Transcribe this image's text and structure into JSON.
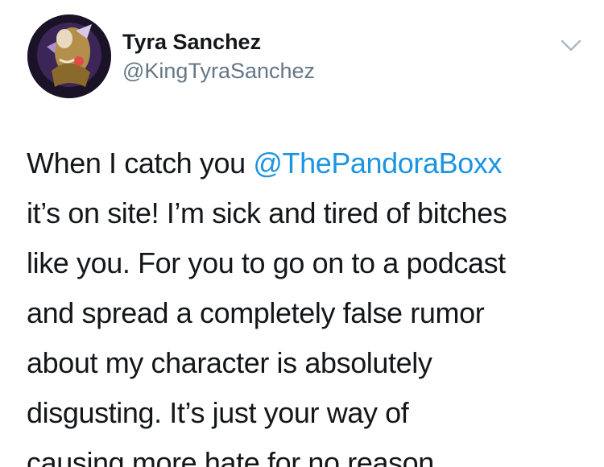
{
  "tweet": {
    "author": {
      "display_name": "Tyra Sanchez",
      "handle": "@KingTyraSanchez"
    },
    "icons": {
      "avatar": "avatar-image",
      "menu": "chevron-down-icon"
    },
    "colors": {
      "text": "#14171a",
      "secondary": "#657786",
      "mention": "#1b95e0",
      "background": "#ffffff"
    },
    "body": {
      "line1_prefix": "When I catch you ",
      "mention": "@ThePandoraBoxx",
      "line2": "it’s on site! I’m sick and tired of bitches",
      "line3": "like you. For you to go on to a podcast",
      "line4": "and spread a completely false rumor",
      "line5": "about my character is absolutely",
      "line6": "disgusting. It’s just your way of",
      "line7": "causing more hate for no reason"
    }
  }
}
